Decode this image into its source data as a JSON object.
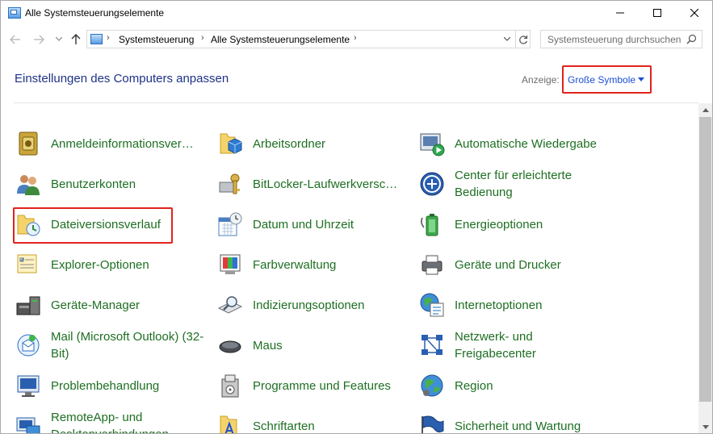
{
  "window": {
    "title": "Alle Systemsteuerungselemente"
  },
  "address": {
    "crumbs": [
      "Systemsteuerung",
      "Alle Systemsteuerungselemente"
    ]
  },
  "search": {
    "placeholder": "Systemsteuerung durchsuchen"
  },
  "header": {
    "title": "Einstellungen des Computers anpassen",
    "view_label": "Anzeige:",
    "view_value": "Große Symbole"
  },
  "colors": {
    "link": "#1d6f22",
    "title": "#1e3287",
    "accent": "#1a4fd6",
    "highlight": "#e0231c"
  },
  "items": [
    [
      "Anmeldeinformationsverwaltung",
      "Arbeitsordner",
      "Automatische Wiedergabe"
    ],
    [
      "Benutzerkonten",
      "BitLocker-Laufwerkverschlüsselung",
      "Center für erleichterte Bedienung"
    ],
    [
      "Dateiversionsverlauf",
      "Datum und Uhrzeit",
      "Energieoptionen"
    ],
    [
      "Explorer-Optionen",
      "Farbverwaltung",
      "Geräte und Drucker"
    ],
    [
      "Geräte-Manager",
      "Indizierungsoptionen",
      "Internetoptionen"
    ],
    [
      "Mail (Microsoft Outlook) (32-Bit)",
      "Maus",
      "Netzwerk- und Freigabecenter"
    ],
    [
      "Problembehandlung",
      "Programme und Features",
      "Region"
    ],
    [
      "RemoteApp- und Desktopverbindungen",
      "Schriftarten",
      "Sicherheit und Wartung"
    ]
  ],
  "item_icons": [
    [
      "credential-manager-icon",
      "work-folders-icon",
      "autoplay-icon"
    ],
    [
      "user-accounts-icon",
      "bitlocker-icon",
      "ease-of-access-icon"
    ],
    [
      "file-history-icon",
      "date-time-icon",
      "power-options-icon"
    ],
    [
      "explorer-options-icon",
      "color-management-icon",
      "devices-printers-icon"
    ],
    [
      "device-manager-icon",
      "indexing-options-icon",
      "internet-options-icon"
    ],
    [
      "mail-icon",
      "mouse-icon",
      "network-sharing-icon"
    ],
    [
      "troubleshooting-icon",
      "programs-features-icon",
      "region-icon"
    ],
    [
      "remoteapp-icon",
      "fonts-icon",
      "security-maintenance-icon"
    ]
  ]
}
